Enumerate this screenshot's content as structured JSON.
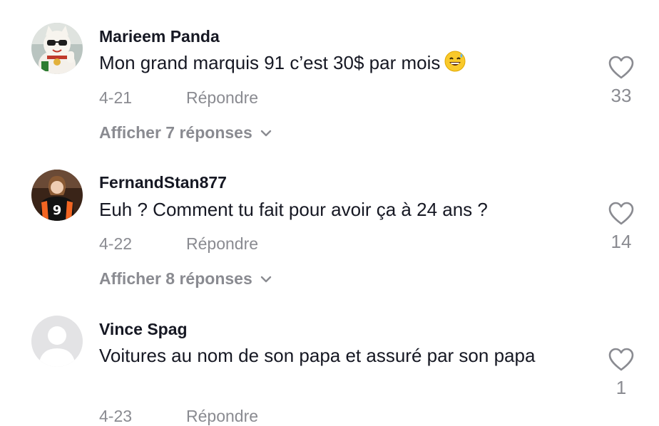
{
  "comments": [
    {
      "username": "Marieem Panda",
      "text": "Mon grand marquis 91 c’est 30$ par mois",
      "emoji": "grinning-sweat-emoji",
      "date": "4-21",
      "reply_label": "Répondre",
      "view_replies": "Afficher 7 réponses",
      "likes": "33",
      "avatar": "lucky-cat-avatar"
    },
    {
      "username": "FernandStan877",
      "text": "Euh ? Comment tu fait pour avoir ça à 24 ans ?",
      "date": "4-22",
      "reply_label": "Répondre",
      "view_replies": "Afficher 8 réponses",
      "likes": "14",
      "avatar": "football-player-avatar"
    },
    {
      "username": "Vince Spag",
      "text": "Voitures au nom de son papa et assuré par son papa",
      "date": "4-23",
      "reply_label": "Répondre",
      "likes": "1",
      "avatar": "default-avatar"
    }
  ],
  "colors": {
    "primary_text": "#161823",
    "secondary_text": "#8a8b91",
    "background": "#ffffff"
  }
}
